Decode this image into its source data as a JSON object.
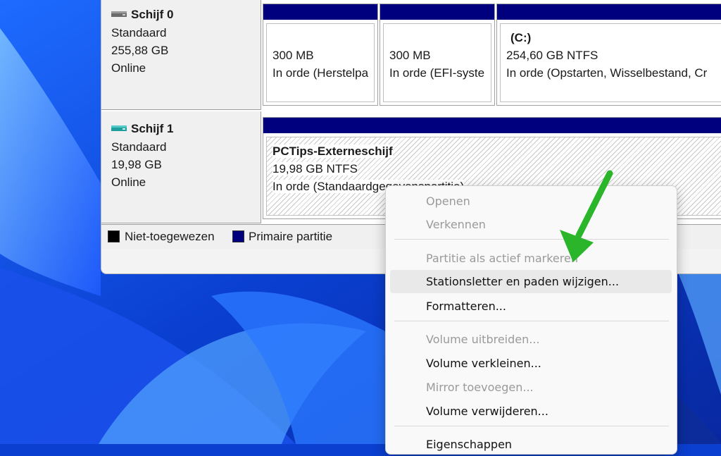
{
  "disks": [
    {
      "name": "Schijf 0",
      "type": "Standaard",
      "size": "255,88 GB",
      "status": "Online",
      "icon": "hard-disk-icon"
    },
    {
      "name": "Schijf 1",
      "type": "Standaard",
      "size": "19,98 GB",
      "status": "Online",
      "icon": "external-disk-icon"
    }
  ],
  "partitions": {
    "p1": {
      "size": "300 MB",
      "status": "In orde (Herstelpa"
    },
    "p2": {
      "size": "300 MB",
      "status": "In orde (EFI-syste"
    },
    "p3": {
      "label": "(C:)",
      "size": "254,60 GB NTFS",
      "status": "In orde (Opstarten, Wisselbestand, Cr"
    },
    "p4": {
      "label": "PCTips-Externeschijf",
      "size": "19,98 GB NTFS",
      "status": "In orde (Standaardgegevenspartitie)"
    }
  },
  "legend": {
    "unallocated": "Niet-toegewezen",
    "primary": "Primaire partitie"
  },
  "menu": {
    "open": "Openen",
    "explore": "Verkennen",
    "mark_active": "Partitie als actief markeren",
    "change_letter": "Stationsletter en paden wijzigen...",
    "format": "Formatteren...",
    "extend": "Volume uitbreiden...",
    "shrink": "Volume verkleinen...",
    "mirror": "Mirror toevoegen...",
    "delete": "Volume verwijderen...",
    "properties": "Eigenschappen"
  },
  "colors": {
    "primary_partition": "#00007f",
    "unallocated": "#000000",
    "arrow": "#2bb52b",
    "wallpaper": "#0a3fd0"
  }
}
